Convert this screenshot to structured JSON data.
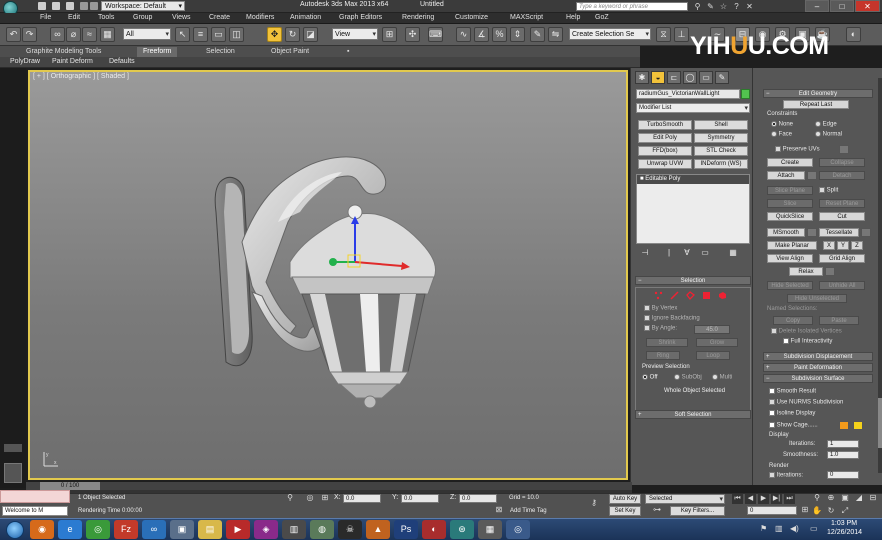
{
  "titlebar": {
    "workspace": "Workspace: Default",
    "app_title": "Autodesk 3ds Max  2013 x64",
    "doc_title": "Untitled",
    "search_placeholder": "Type a keyword or phrase"
  },
  "menu": [
    "File",
    "Edit",
    "Tools",
    "Group",
    "Views",
    "Create",
    "Modifiers",
    "Animation",
    "Graph Editors",
    "Rendering",
    "Customize",
    "MAXScript",
    "Help",
    "GoZ"
  ],
  "toolbar": {
    "filter_value": "All",
    "view_value": "View",
    "named_selection": "Create Selection Se"
  },
  "watermark": {
    "part1": "YIH",
    "part2": "U",
    "part3": "U.COM"
  },
  "ribbon": {
    "tabs": [
      "Graphite Modeling Tools",
      "Freeform",
      "Selection",
      "Object Paint"
    ],
    "active_tab": "Freeform",
    "subtabs": [
      "PolyDraw",
      "Paint Deform",
      "Defaults"
    ]
  },
  "viewport": {
    "label": "[ + ] [ Orthographic ] [ Shaded ]"
  },
  "command_panel": {
    "object_name": "radiumGus_VictorianWallLight",
    "object_color": "#52c24f",
    "modifier_list": "Modifier List",
    "modifier_buttons": [
      "TurboSmooth",
      "Shell",
      "Edit Poly",
      "Symmetry",
      "FFD(box)",
      "STL Check",
      "Unwrap UVW",
      "INDeform (WS)"
    ],
    "stack_item": "Editable Poly",
    "selection": {
      "title": "Selection",
      "by_vertex": "By Vertex",
      "ignore_backfacing": "Ignore Backfacing",
      "by_angle": "By Angle:",
      "angle_value": "45.0",
      "shrink": "Shrink",
      "grow": "Grow",
      "ring": "Ring",
      "loop": "Loop",
      "preview_title": "Preview Selection",
      "preview_off": "Off",
      "preview_subobj": "SubObj",
      "preview_multi": "Multi",
      "status": "Whole Object Selected"
    },
    "soft_selection": "Soft Selection"
  },
  "edit_panel": {
    "edit_geometry": "Edit Geometry",
    "repeat_last": "Repeat Last",
    "constraints": "Constraints",
    "c_none": "None",
    "c_edge": "Edge",
    "c_face": "Face",
    "c_normal": "Normal",
    "preserve_uvs": "Preserve UVs",
    "create": "Create",
    "collapse": "Collapse",
    "attach": "Attach",
    "detach": "Detach",
    "slice_plane": "Slice Plane",
    "split": "Split",
    "slice": "Slice",
    "reset_plane": "Reset Plane",
    "quickslice": "QuickSlice",
    "cut": "Cut",
    "msmooth": "MSmooth",
    "tessellate": "Tessellate",
    "make_planar": "Make Planar",
    "x": "X",
    "y": "Y",
    "z": "Z",
    "view_align": "View Align",
    "grid_align": "Grid Align",
    "relax": "Relax",
    "hide_selected": "Hide Selected",
    "unhide_all": "Unhide All",
    "hide_unselected": "Hide Unselected",
    "named_selections": "Named Selections:",
    "copy": "Copy",
    "paste": "Paste",
    "delete_isolated": "Delete Isolated Vertices",
    "full_interactivity": "Full Interactivity",
    "subdivision_displacement": "Subdivision Displacement",
    "paint_deformation": "Paint Deformation",
    "subdivision_surface": "Subdivision Surface",
    "smooth_result": "Smooth Result",
    "use_nurms": "Use NURMS Subdivision",
    "isoline_display": "Isoline Display",
    "show_cage": "Show Cage......",
    "cage_color1": "#f29a1c",
    "cage_color2": "#f4d21b",
    "display": "Display",
    "iterations_label": "Iterations:",
    "iterations_value": "1",
    "smoothness_label": "Smoothness:",
    "smoothness_value": "1.0",
    "render": "Render",
    "render_iterations_value": "0"
  },
  "timeline": {
    "slider_text": "0 / 100"
  },
  "status": {
    "welcome": "Welcome to M",
    "objects_selected": "1 Object Selected",
    "rendering_time": "Rendering Time  0:00:00",
    "x_label": "X:",
    "y_label": "Y:",
    "z_label": "Z:",
    "x_value": "0.0",
    "y_value": "0.0",
    "z_value": "0.0",
    "grid": "Grid = 10.0",
    "add_time_tag": "Add Time Tag",
    "auto_key": "Auto Key",
    "set_key": "Set Key",
    "selected": "Selected",
    "key_filters": "Key Filters...",
    "frame_value": "0"
  },
  "taskbar": {
    "time": "1:03 PM",
    "date": "12/26/2014"
  }
}
